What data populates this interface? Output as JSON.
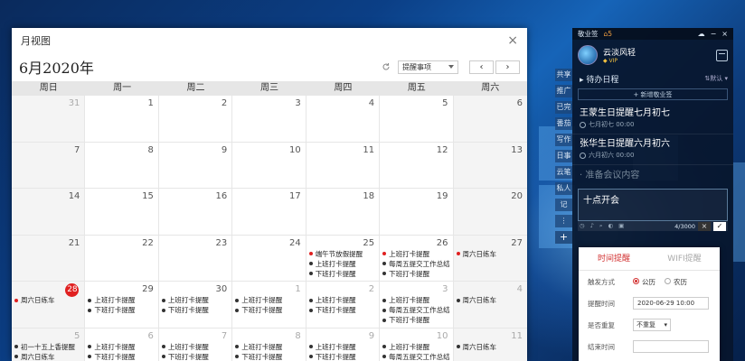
{
  "calendar": {
    "title": "月视图",
    "close": "×",
    "month": "6月2020年",
    "type_select": "提醒事项",
    "prev": "‹",
    "next": "›",
    "weekdays": [
      "周日",
      "周一",
      "周二",
      "周三",
      "周四",
      "周五",
      "周六"
    ],
    "weeks": [
      [
        {
          "d": "31",
          "o": true
        },
        {
          "d": "1"
        },
        {
          "d": "2"
        },
        {
          "d": "3"
        },
        {
          "d": "4"
        },
        {
          "d": "5"
        },
        {
          "d": "6"
        }
      ],
      [
        {
          "d": "7"
        },
        {
          "d": "8"
        },
        {
          "d": "9"
        },
        {
          "d": "10"
        },
        {
          "d": "11"
        },
        {
          "d": "12"
        },
        {
          "d": "13"
        }
      ],
      [
        {
          "d": "14"
        },
        {
          "d": "15"
        },
        {
          "d": "16"
        },
        {
          "d": "17"
        },
        {
          "d": "18"
        },
        {
          "d": "19"
        },
        {
          "d": "20"
        }
      ],
      [
        {
          "d": "21"
        },
        {
          "d": "22"
        },
        {
          "d": "23"
        },
        {
          "d": "24"
        },
        {
          "d": "25",
          "ev": [
            {
              "c": "red",
              "t": "端午节放假提醒"
            },
            {
              "c": "gray",
              "t": "上班打卡提醒"
            },
            {
              "c": "gray",
              "t": "下班打卡提醒"
            }
          ]
        },
        {
          "d": "26",
          "ev": [
            {
              "c": "red",
              "t": "上班打卡提醒"
            },
            {
              "c": "gray",
              "t": "每周五提交工作总结"
            },
            {
              "c": "gray",
              "t": "下班打卡提醒"
            }
          ]
        },
        {
          "d": "27",
          "ev": [
            {
              "c": "red",
              "t": "周六日练车"
            }
          ]
        }
      ],
      [
        {
          "d": "28",
          "today": true,
          "ev": [
            {
              "c": "red",
              "t": "周六日练车"
            }
          ]
        },
        {
          "d": "29",
          "ev": [
            {
              "c": "gray",
              "t": "上班打卡提醒"
            },
            {
              "c": "gray",
              "t": "下班打卡提醒"
            }
          ]
        },
        {
          "d": "30",
          "ev": [
            {
              "c": "gray",
              "t": "上班打卡提醒"
            },
            {
              "c": "gray",
              "t": "下班打卡提醒"
            }
          ]
        },
        {
          "d": "1",
          "o": true,
          "ev": [
            {
              "c": "gray",
              "t": "上班打卡提醒"
            },
            {
              "c": "gray",
              "t": "下班打卡提醒"
            }
          ]
        },
        {
          "d": "2",
          "o": true,
          "ev": [
            {
              "c": "gray",
              "t": "上班打卡提醒"
            },
            {
              "c": "gray",
              "t": "下班打卡提醒"
            }
          ]
        },
        {
          "d": "3",
          "o": true,
          "ev": [
            {
              "c": "gray",
              "t": "上班打卡提醒"
            },
            {
              "c": "gray",
              "t": "每周五提交工作总结"
            },
            {
              "c": "gray",
              "t": "下班打卡提醒"
            }
          ]
        },
        {
          "d": "4",
          "o": true,
          "ev": [
            {
              "c": "gray",
              "t": "周六日练车"
            }
          ]
        }
      ],
      [
        {
          "d": "5",
          "o": true,
          "ev": [
            {
              "c": "gray",
              "t": "初一十五上香提醒"
            },
            {
              "c": "gray",
              "t": "周六日练车"
            }
          ]
        },
        {
          "d": "6",
          "o": true,
          "ev": [
            {
              "c": "gray",
              "t": "上班打卡提醒"
            },
            {
              "c": "gray",
              "t": "下班打卡提醒"
            }
          ]
        },
        {
          "d": "7",
          "o": true,
          "ev": [
            {
              "c": "gray",
              "t": "上班打卡提醒"
            },
            {
              "c": "gray",
              "t": "下班打卡提醒"
            }
          ]
        },
        {
          "d": "8",
          "o": true,
          "ev": [
            {
              "c": "gray",
              "t": "上班打卡提醒"
            },
            {
              "c": "gray",
              "t": "下班打卡提醒"
            }
          ]
        },
        {
          "d": "9",
          "o": true,
          "ev": [
            {
              "c": "gray",
              "t": "上班打卡提醒"
            },
            {
              "c": "gray",
              "t": "下班打卡提醒"
            }
          ]
        },
        {
          "d": "10",
          "o": true,
          "ev": [
            {
              "c": "gray",
              "t": "上班打卡提醒"
            },
            {
              "c": "gray",
              "t": "每周五提交工作总结"
            }
          ]
        },
        {
          "d": "11",
          "o": true,
          "ev": [
            {
              "c": "gray",
              "t": "周六日练车"
            }
          ]
        }
      ]
    ]
  },
  "side_strip": [
    "共享",
    "推广",
    "已完",
    "番茄",
    "写作",
    "日事",
    "云笔",
    "私人",
    "记"
  ],
  "notes": {
    "app_name": "敬业签",
    "bell_count": "5",
    "username": "云淡风轻",
    "vip": "VIP",
    "todo_title": "待办日程",
    "sort_label": "默认",
    "new_note": "+ 新增敬业签",
    "items": [
      {
        "title": "王蒙生日提醒七月初七",
        "date": "七月初七 00:00"
      },
      {
        "title": "张华生日提醒六月初六",
        "date": "六月初六 00:00"
      }
    ],
    "placeholder": "准备会议内容",
    "editor_text": "十点开会",
    "char_count": "4/3000",
    "cancel": "×",
    "confirm": "✓"
  },
  "reminder": {
    "tab_time": "时间提醒",
    "tab_wifi": "WIFI提醒",
    "trigger_label": "触发方式",
    "opt_solar": "公历",
    "opt_lunar": "农历",
    "time_label": "提醒时间",
    "time_value": "2020-06-29 10:00",
    "repeat_label": "是否重复",
    "repeat_value": "不重复",
    "end_label": "结束时间"
  },
  "colors": {
    "accent_red": "#d23030",
    "panel_bg": "#08162c"
  }
}
